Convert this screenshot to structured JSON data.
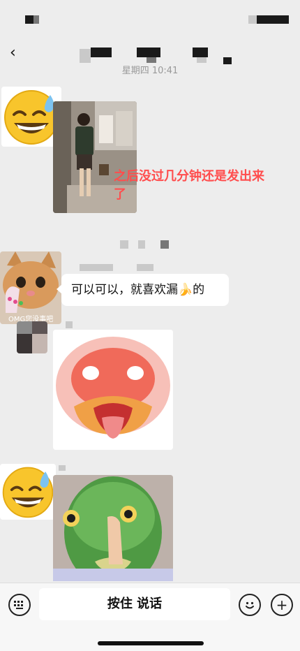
{
  "status_bar": {
    "time": "",
    "battery": ""
  },
  "nav": {
    "back_glyph": "‹",
    "title": ""
  },
  "chat": {
    "timestamp": "星期四 10:41",
    "messages": [
      {
        "type": "image",
        "sender": "left-1",
        "overlay_text": "之后没过几分钟还是发出来了"
      },
      {
        "type": "text",
        "sender": "left-2",
        "text_before": "可以可以，就喜欢漏",
        "emoji": "🍌",
        "text_after": "的"
      },
      {
        "type": "sticker",
        "sender": "left-3"
      },
      {
        "type": "sticker",
        "sender": "left-1"
      }
    ],
    "avatar_caption": "OMG您没事吧"
  },
  "input_bar": {
    "voice_label": "按住 说话",
    "keyboard_icon": "keyboard-icon",
    "emoji_icon": "smile-icon",
    "plus_icon": "plus-icon",
    "plus_glyph": "+"
  },
  "colors": {
    "overlay_text": "#ff4d4d",
    "background": "#ededed"
  }
}
